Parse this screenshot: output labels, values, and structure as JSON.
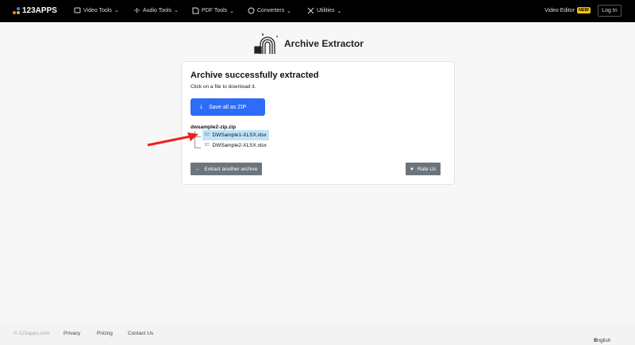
{
  "header": {
    "logo": "123APPS",
    "nav": [
      {
        "label": "Video Tools",
        "icon": "video-icon"
      },
      {
        "label": "Audio Tools",
        "icon": "audio-icon"
      },
      {
        "label": "PDF Tools",
        "icon": "pdf-icon"
      },
      {
        "label": "Converters",
        "icon": "converter-icon"
      },
      {
        "label": "Utilities",
        "icon": "utilities-icon"
      }
    ],
    "video_editor": "Video Editor",
    "new_badge": "NEW",
    "login": "Log In"
  },
  "app": {
    "title": "Archive Extractor"
  },
  "card": {
    "heading": "Archive successfully extracted",
    "subtitle": "Click on a file to download it.",
    "save_zip": "Save all as ZIP",
    "archive_name": "dwsample2-zip.zip",
    "files": [
      "DWSample1-XLSX.xlsx",
      "DWSample2-XLSX.xlsx"
    ],
    "extract_another": "Extract another archive",
    "rate_us": "Rate Us"
  },
  "footer": {
    "copyright": "© 123apps.com",
    "links": [
      "Privacy",
      "Pricing",
      "Contact Us"
    ],
    "language": "English"
  },
  "colors": {
    "primary": "#2d6cf6",
    "selected": "#bfe3f7",
    "arrow": "#e8231f"
  }
}
